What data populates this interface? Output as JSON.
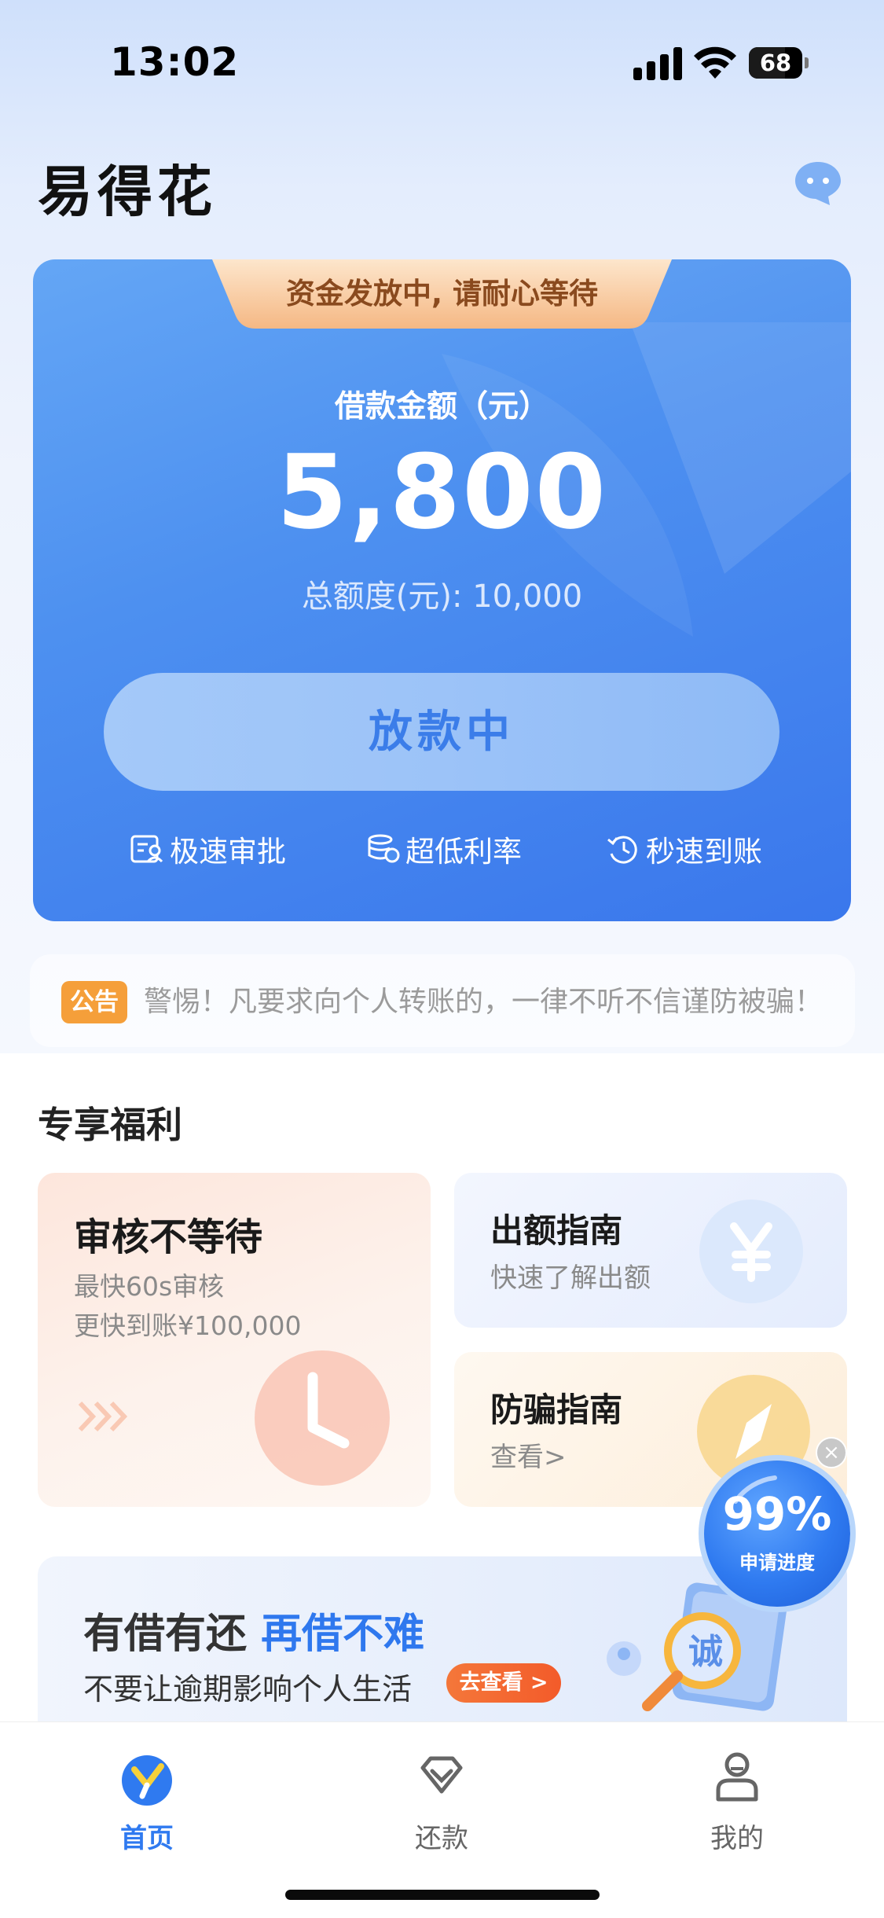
{
  "status_bar": {
    "time": "13:02",
    "battery": "68",
    "battery_level": 0.68
  },
  "header": {
    "app_title": "易得花",
    "chat_icon": "chat-bubble-icon"
  },
  "hero": {
    "ribbon_text": "资金发放中, 请耐心等待",
    "amount_label": "借款金额（元）",
    "amount_value": "5,800",
    "total_limit": "总额度(元): 10,000",
    "status_button": "放款中",
    "features": [
      {
        "icon": "approval-doc-icon",
        "label": "极速审批"
      },
      {
        "icon": "coins-stack-icon",
        "label": "超低利率"
      },
      {
        "icon": "clock-history-icon",
        "label": "秒速到账"
      }
    ],
    "colors": {
      "card": "#4d90f0",
      "ribbon": "#f6c28e"
    }
  },
  "notice": {
    "tag": "公告",
    "text": "警惕！凡要求向个人转账的，一律不听不信谨防被骗！"
  },
  "benefits": {
    "title": "专享福利",
    "card_review": {
      "title": "审核不等待",
      "line1": "最快60s审核",
      "line2": "更快到账¥100,000",
      "icon": "clock-icon"
    },
    "card_quota_guide": {
      "title": "出额指南",
      "subtitle": "快速了解出额",
      "icon": "yen-icon"
    },
    "card_fraud_guide": {
      "title": "防骗指南",
      "subtitle": "查看>",
      "icon": "compass-icon"
    }
  },
  "banner": {
    "headline_part1": "有借有还 ",
    "headline_part2": "再借不难",
    "subline": "不要让逾期影响个人生活",
    "cta": "去查看 >"
  },
  "progress_widget": {
    "percent": "99%",
    "label": "申请进度",
    "close": "×"
  },
  "tabbar": {
    "tabs": [
      {
        "label": "首页",
        "icon": "home-logo-icon",
        "active": true
      },
      {
        "label": "还款",
        "icon": "repay-diamond-icon",
        "active": false
      },
      {
        "label": "我的",
        "icon": "profile-icon",
        "active": false
      }
    ]
  }
}
